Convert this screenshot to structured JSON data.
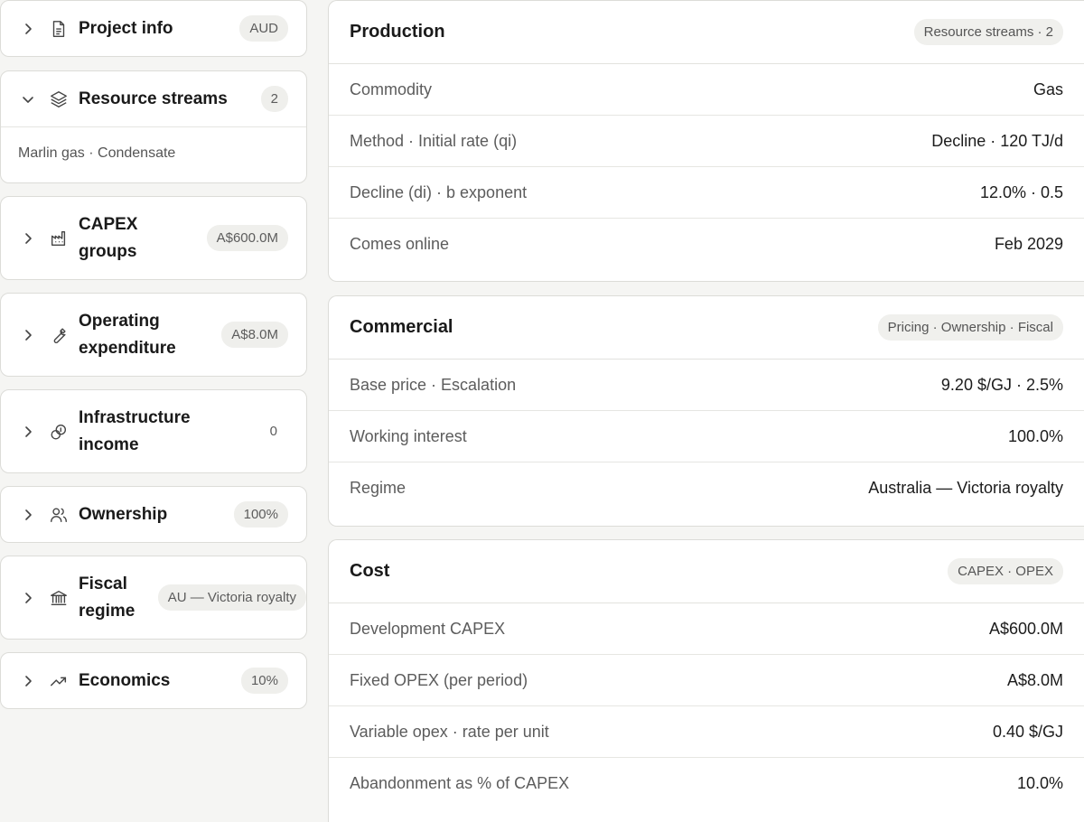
{
  "sidebar": {
    "project_info": {
      "title": "Project info",
      "badge": "AUD"
    },
    "resource_streams": {
      "title": "Resource streams",
      "badge": "2",
      "summary": "Marlin gas · Condensate"
    },
    "capex": {
      "title_line1": "CAPEX",
      "title_line2": "groups",
      "badge": "A$600.0M"
    },
    "opex": {
      "title_line1": "Operating",
      "title_line2": "expenditure",
      "badge": "A$8.0M"
    },
    "infra": {
      "title_line1": "Infrastructure",
      "title_line2": "income",
      "badge": "0"
    },
    "ownership": {
      "title": "Ownership",
      "badge": "100%"
    },
    "fiscal": {
      "title_line1": "Fiscal",
      "title_line2": "regime",
      "badge": "AU — Victoria royalty"
    },
    "economics": {
      "title": "Economics",
      "badge": "10%"
    }
  },
  "production": {
    "title": "Production",
    "pill": "Resource streams · 2",
    "rows": [
      {
        "label": "Commodity",
        "value": "Gas"
      },
      {
        "label": "Method · Initial rate (qi)",
        "value": "Decline · 120 TJ/d"
      },
      {
        "label": "Decline (di) · b exponent",
        "value": "12.0% · 0.5"
      },
      {
        "label": "Comes online",
        "value": "Feb 2029"
      }
    ]
  },
  "commercial": {
    "title": "Commercial",
    "pill": "Pricing · Ownership · Fiscal",
    "rows": [
      {
        "label": "Base price · Escalation",
        "value": "9.20 $/GJ · 2.5%"
      },
      {
        "label": "Working interest",
        "value": "100.0%"
      },
      {
        "label": "Regime",
        "value": "Australia — Victoria royalty"
      }
    ]
  },
  "cost": {
    "title": "Cost",
    "pill": "CAPEX · OPEX",
    "rows": [
      {
        "label": "Development CAPEX",
        "value": "A$600.0M"
      },
      {
        "label": "Fixed OPEX (per period)",
        "value": "A$8.0M"
      },
      {
        "label": "Variable opex · rate per unit",
        "value": "0.40 $/GJ"
      },
      {
        "label": "Abandonment as % of CAPEX",
        "value": "10.0%"
      }
    ]
  }
}
